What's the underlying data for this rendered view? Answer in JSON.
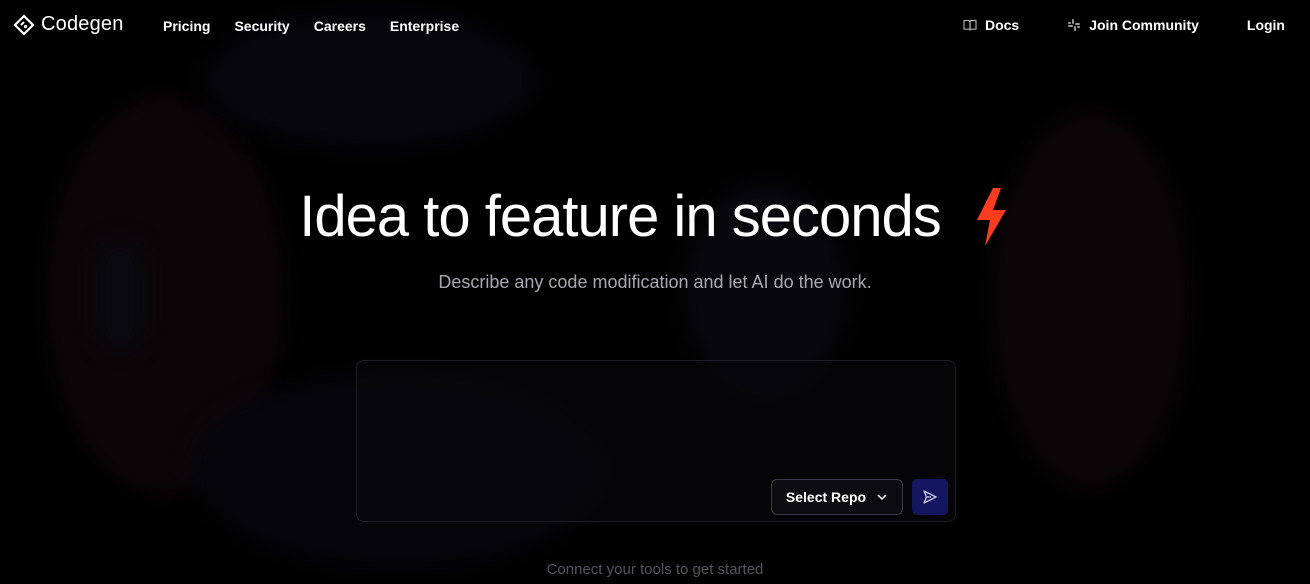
{
  "brand": {
    "name": "Codegen",
    "icon": "codegen-diamond-logo"
  },
  "nav": {
    "links": [
      "Pricing",
      "Security",
      "Careers",
      "Enterprise"
    ],
    "docs": {
      "label": "Docs",
      "icon": "book-icon"
    },
    "community": {
      "label": "Join Community",
      "icon": "slack-icon"
    },
    "login": "Login"
  },
  "hero": {
    "title": "Idea to feature in seconds",
    "title_icon": "lightning-bolt-icon",
    "subtitle": "Describe any code modification and let AI do the work."
  },
  "prompt": {
    "value": "",
    "select_repo_label": "Select Repo",
    "select_icon": "chevron-down-icon",
    "send_icon": "send-icon"
  },
  "footer_hint": "Connect your tools to get started",
  "colors": {
    "background": "#000000",
    "accent_bolt": "#ff3b1f",
    "send_button": "#141660",
    "subtitle": "#a8a8ae"
  }
}
